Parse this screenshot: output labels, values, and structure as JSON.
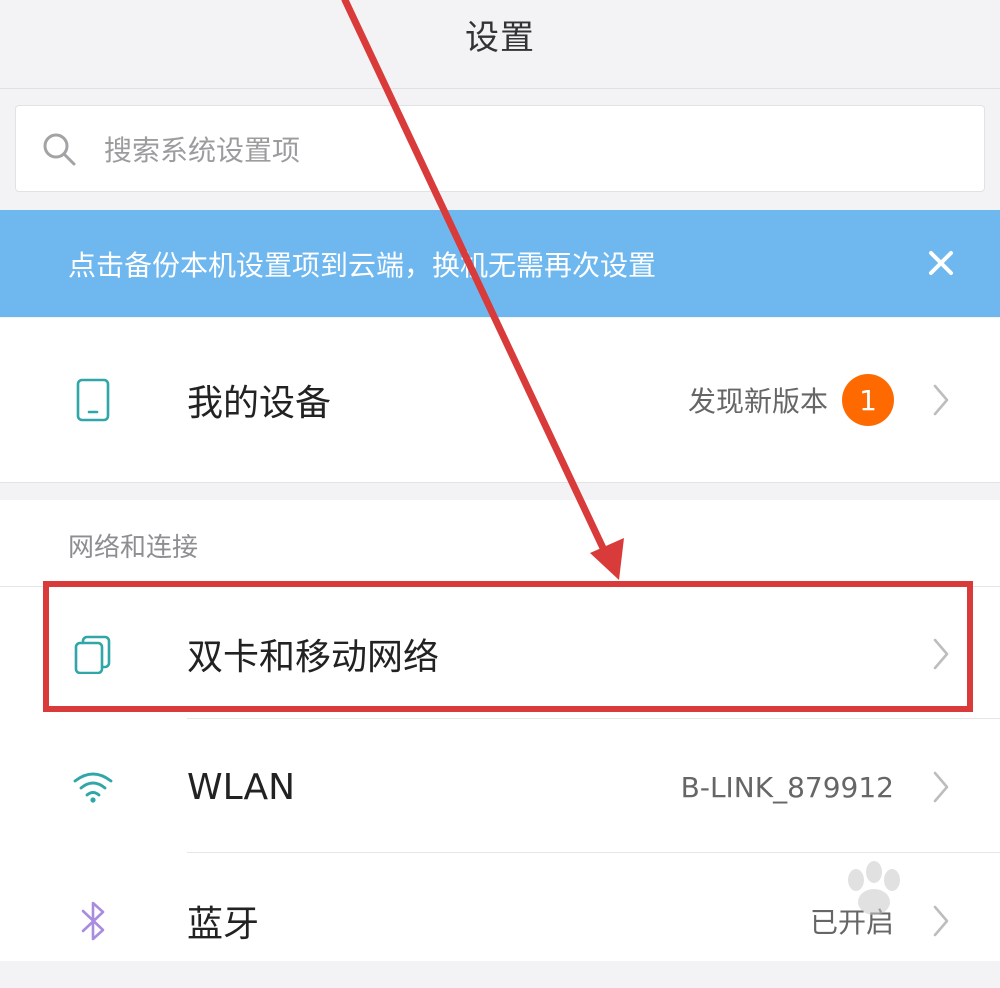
{
  "header": {
    "title": "设置"
  },
  "search": {
    "placeholder": "搜索系统设置项"
  },
  "banner": {
    "text": "点击备份本机设置项到云端，换机无需再次设置"
  },
  "my_device": {
    "label": "我的设备",
    "value": "发现新版本",
    "badge": "1"
  },
  "network_section": {
    "header": "网络和连接",
    "items": [
      {
        "label": "双卡和移动网络",
        "value": ""
      },
      {
        "label": "WLAN",
        "value": "B-LINK_879912"
      },
      {
        "label": "蓝牙",
        "value": "已开启"
      }
    ]
  },
  "colors": {
    "accent_blue": "#6fb8ef",
    "icon_teal": "#2fa7a8",
    "icon_purple": "#a98ce0",
    "badge_orange": "#ff6a00",
    "annotation_red": "#d93a3a"
  }
}
